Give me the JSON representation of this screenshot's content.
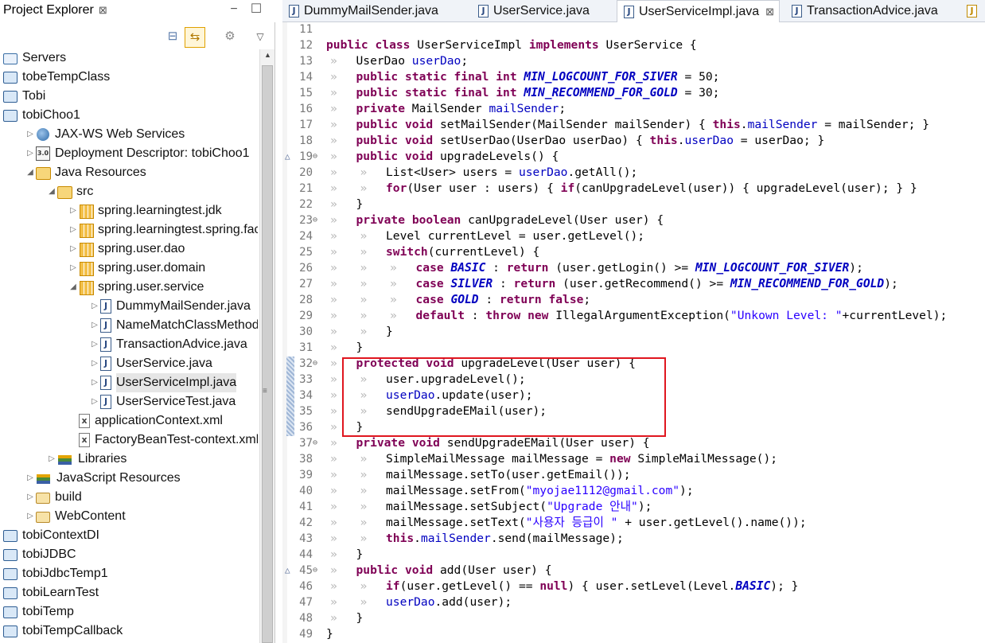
{
  "explorer": {
    "title": "Project Explorer",
    "close_glyph": "⊠",
    "minimize_glyph": "−",
    "maximize_glyph": "☐",
    "toolbar": {
      "collapse_icon": "collapse-all-icon",
      "link_icon": "link-with-editor-icon",
      "menu_icon": "view-menu-icon"
    },
    "tree": [
      {
        "label": "Servers",
        "indent": 0,
        "twisty": "",
        "icon": "servers"
      },
      {
        "label": "tobeTempClass",
        "indent": 0,
        "twisty": "",
        "icon": "project"
      },
      {
        "label": "Tobi",
        "indent": 0,
        "twisty": "",
        "icon": "project"
      },
      {
        "label": "tobiChoo1",
        "indent": 0,
        "twisty": "",
        "icon": "project"
      },
      {
        "label": "JAX-WS Web Services",
        "indent": 1,
        "twisty": "▷",
        "icon": "ws"
      },
      {
        "label": "Deployment Descriptor: tobiChoo1",
        "indent": 1,
        "twisty": "▷",
        "icon": "dd"
      },
      {
        "label": "Java Resources",
        "indent": 1,
        "twisty": "◢",
        "icon": "src"
      },
      {
        "label": "src",
        "indent": 2,
        "twisty": "◢",
        "icon": "src"
      },
      {
        "label": "spring.learningtest.jdk",
        "indent": 3,
        "twisty": "▷",
        "icon": "pkg"
      },
      {
        "label": "spring.learningtest.spring.facto",
        "indent": 3,
        "twisty": "▷",
        "icon": "pkg"
      },
      {
        "label": "spring.user.dao",
        "indent": 3,
        "twisty": "▷",
        "icon": "pkg"
      },
      {
        "label": "spring.user.domain",
        "indent": 3,
        "twisty": "▷",
        "icon": "pkg"
      },
      {
        "label": "spring.user.service",
        "indent": 3,
        "twisty": "◢",
        "icon": "pkg"
      },
      {
        "label": "DummyMailSender.java",
        "indent": 4,
        "twisty": "▷",
        "icon": "java"
      },
      {
        "label": "NameMatchClassMethodP",
        "indent": 4,
        "twisty": "▷",
        "icon": "java"
      },
      {
        "label": "TransactionAdvice.java",
        "indent": 4,
        "twisty": "▷",
        "icon": "java"
      },
      {
        "label": "UserService.java",
        "indent": 4,
        "twisty": "▷",
        "icon": "java"
      },
      {
        "label": "UserServiceImpl.java",
        "indent": 4,
        "twisty": "▷",
        "icon": "java",
        "selected": true
      },
      {
        "label": "UserServiceTest.java",
        "indent": 4,
        "twisty": "▷",
        "icon": "java"
      },
      {
        "label": "applicationContext.xml",
        "indent": 3,
        "twisty": "",
        "icon": "xml"
      },
      {
        "label": "FactoryBeanTest-context.xml",
        "indent": 3,
        "twisty": "",
        "icon": "xml"
      },
      {
        "label": "Libraries",
        "indent": 2,
        "twisty": "▷",
        "icon": "lib"
      },
      {
        "label": "JavaScript Resources",
        "indent": 1,
        "twisty": "▷",
        "icon": "lib"
      },
      {
        "label": "build",
        "indent": 1,
        "twisty": "▷",
        "icon": "open"
      },
      {
        "label": "WebContent",
        "indent": 1,
        "twisty": "▷",
        "icon": "open"
      },
      {
        "label": "tobiContextDI",
        "indent": 0,
        "twisty": "",
        "icon": "project"
      },
      {
        "label": "tobiJDBC",
        "indent": 0,
        "twisty": "",
        "icon": "project"
      },
      {
        "label": "tobiJdbcTemp1",
        "indent": 0,
        "twisty": "",
        "icon": "project"
      },
      {
        "label": "tobiLearnTest",
        "indent": 0,
        "twisty": "",
        "icon": "project"
      },
      {
        "label": "tobiTemp",
        "indent": 0,
        "twisty": "",
        "icon": "project"
      },
      {
        "label": "tobiTempCallback",
        "indent": 0,
        "twisty": "",
        "icon": "project"
      }
    ]
  },
  "editor": {
    "tabs": [
      {
        "label": "DummyMailSender.java",
        "active": false,
        "close": ""
      },
      {
        "label": "UserService.java",
        "active": false,
        "close": ""
      },
      {
        "label": "UserServiceImpl.java",
        "active": true,
        "close": "⊠"
      },
      {
        "label": "TransactionAdvice.java",
        "active": false,
        "close": ""
      }
    ],
    "lines": [
      {
        "n": "11",
        "ann": "",
        "fold": "",
        "indent": 0,
        "html": ""
      },
      {
        "n": "12",
        "ann": "",
        "fold": "",
        "indent": 0,
        "html": "<span class='kw'>public</span> <span class='kw'>class</span> UserServiceImpl <span class='kw'>implements</span> UserService {"
      },
      {
        "n": "13",
        "ann": "",
        "fold": "",
        "indent": 1,
        "html": "UserDao <span class='fld'>userDao</span>;"
      },
      {
        "n": "14",
        "ann": "",
        "fold": "",
        "indent": 1,
        "html": "<span class='kw'>public</span> <span class='kw'>static</span> <span class='kw'>final</span> <span class='kw'>int</span> <span class='sfld'>MIN_LOGCOUNT_FOR_SIVER</span> = 50;"
      },
      {
        "n": "15",
        "ann": "",
        "fold": "",
        "indent": 1,
        "html": "<span class='kw'>public</span> <span class='kw'>static</span> <span class='kw'>final</span> <span class='kw'>int</span> <span class='sfld'>MIN_RECOMMEND_FOR_GOLD</span> = 30;"
      },
      {
        "n": "16",
        "ann": "",
        "fold": "",
        "indent": 1,
        "html": "<span class='kw'>private</span> MailSender <span class='fld'>mailSender</span>;"
      },
      {
        "n": "17",
        "ann": "",
        "fold": "",
        "indent": 1,
        "html": "<span class='kw'>public</span> <span class='kw'>void</span> setMailSender(MailSender mailSender) { <span class='kw'>this</span>.<span class='fld'>mailSender</span> = mailSender; }"
      },
      {
        "n": "18",
        "ann": "",
        "fold": "",
        "indent": 1,
        "html": "<span class='kw'>public</span> <span class='kw'>void</span> setUserDao(UserDao userDao) { <span class='kw'>this</span>.<span class='fld'>userDao</span> = userDao; }"
      },
      {
        "n": "19",
        "ann": "△",
        "fold": "⊖",
        "indent": 1,
        "html": "<span class='kw'>public</span> <span class='kw'>void</span> upgradeLevels() {"
      },
      {
        "n": "20",
        "ann": "",
        "fold": "",
        "indent": 2,
        "html": "List&lt;User&gt; users = <span class='fld'>userDao</span>.getAll();"
      },
      {
        "n": "21",
        "ann": "",
        "fold": "",
        "indent": 2,
        "html": "<span class='kw'>for</span>(User user : users) { <span class='kw'>if</span>(canUpgradeLevel(user)) { upgradeLevel(user); } }"
      },
      {
        "n": "22",
        "ann": "",
        "fold": "",
        "indent": 1,
        "html": "}"
      },
      {
        "n": "23",
        "ann": "",
        "fold": "⊖",
        "indent": 1,
        "html": "<span class='kw'>private</span> <span class='kw'>boolean</span> canUpgradeLevel(User user) {"
      },
      {
        "n": "24",
        "ann": "",
        "fold": "",
        "indent": 2,
        "html": "Level currentLevel = user.getLevel();"
      },
      {
        "n": "25",
        "ann": "",
        "fold": "",
        "indent": 2,
        "html": "<span class='kw'>switch</span>(currentLevel) {"
      },
      {
        "n": "26",
        "ann": "",
        "fold": "",
        "indent": 3,
        "html": "<span class='kw'>case</span> <span class='sfld'>BASIC</span> : <span class='kw'>return</span> (user.getLogin() &gt;= <span class='sfld'>MIN_LOGCOUNT_FOR_SIVER</span>);"
      },
      {
        "n": "27",
        "ann": "",
        "fold": "",
        "indent": 3,
        "html": "<span class='kw'>case</span> <span class='sfld'>SILVER</span> : <span class='kw'>return</span> (user.getRecommend() &gt;= <span class='sfld'>MIN_RECOMMEND_FOR_GOLD</span>);"
      },
      {
        "n": "28",
        "ann": "",
        "fold": "",
        "indent": 3,
        "html": "<span class='kw'>case</span> <span class='sfld'>GOLD</span> : <span class='kw'>return</span> <span class='kw'>false</span>;"
      },
      {
        "n": "29",
        "ann": "",
        "fold": "",
        "indent": 3,
        "html": "<span class='kw'>default</span> : <span class='kw'>throw</span> <span class='kw'>new</span> IllegalArgumentException(<span class='str'>\"Unkown Level: \"</span>+currentLevel);"
      },
      {
        "n": "30",
        "ann": "",
        "fold": "",
        "indent": 2,
        "html": "}"
      },
      {
        "n": "31",
        "ann": "",
        "fold": "",
        "indent": 1,
        "html": "}"
      },
      {
        "n": "32",
        "ann": "",
        "fold": "⊖",
        "indent": 1,
        "html": "<span class='kw'>protected</span> <span class='kw'>void</span> upgradeLevel(User user) {"
      },
      {
        "n": "33",
        "ann": "",
        "fold": "",
        "indent": 2,
        "html": "user.upgradeLevel();"
      },
      {
        "n": "34",
        "ann": "",
        "fold": "",
        "indent": 2,
        "html": "<span class='fld'>userDao</span>.update(user);"
      },
      {
        "n": "35",
        "ann": "",
        "fold": "",
        "indent": 2,
        "html": "sendUpgradeEMail(user);"
      },
      {
        "n": "36",
        "ann": "",
        "fold": "",
        "indent": 1,
        "html": "}"
      },
      {
        "n": "37",
        "ann": "",
        "fold": "⊖",
        "indent": 1,
        "html": "<span class='kw'>private</span> <span class='kw'>void</span> sendUpgradeEMail(User user) {"
      },
      {
        "n": "38",
        "ann": "",
        "fold": "",
        "indent": 2,
        "html": "SimpleMailMessage mailMessage = <span class='kw'>new</span> SimpleMailMessage();"
      },
      {
        "n": "39",
        "ann": "",
        "fold": "",
        "indent": 2,
        "html": "mailMessage.setTo(user.getEmail());"
      },
      {
        "n": "40",
        "ann": "",
        "fold": "",
        "indent": 2,
        "html": "mailMessage.setFrom(<span class='str'>\"myojae1112@gmail.com\"</span>);"
      },
      {
        "n": "41",
        "ann": "",
        "fold": "",
        "indent": 2,
        "html": "mailMessage.setSubject(<span class='str'>\"Upgrade 안내\"</span>);"
      },
      {
        "n": "42",
        "ann": "",
        "fold": "",
        "indent": 2,
        "html": "mailMessage.setText(<span class='str'>\"사용자 등급이 \"</span> + user.getLevel().name());"
      },
      {
        "n": "43",
        "ann": "",
        "fold": "",
        "indent": 2,
        "html": "<span class='kw'>this</span>.<span class='fld'>mailSender</span>.send(mailMessage);"
      },
      {
        "n": "44",
        "ann": "",
        "fold": "",
        "indent": 1,
        "html": "}"
      },
      {
        "n": "45",
        "ann": "△",
        "fold": "⊖",
        "indent": 1,
        "html": "<span class='kw'>public</span> <span class='kw'>void</span> add(User user) {"
      },
      {
        "n": "46",
        "ann": "",
        "fold": "",
        "indent": 2,
        "html": "<span class='kw'>if</span>(user.getLevel() == <span class='kw'>null</span>) { user.setLevel(Level.<span class='sfld'>BASIC</span>); }"
      },
      {
        "n": "47",
        "ann": "",
        "fold": "",
        "indent": 2,
        "html": "<span class='fld'>userDao</span>.add(user);"
      },
      {
        "n": "48",
        "ann": "",
        "fold": "",
        "indent": 1,
        "html": "}"
      },
      {
        "n": "49",
        "ann": "",
        "fold": "",
        "indent": 0,
        "html": "}"
      }
    ]
  },
  "colors": {
    "keyword": "#7f0055",
    "field": "#0000c0",
    "string": "#2a00ff",
    "highlight_box": "#e0161f"
  }
}
